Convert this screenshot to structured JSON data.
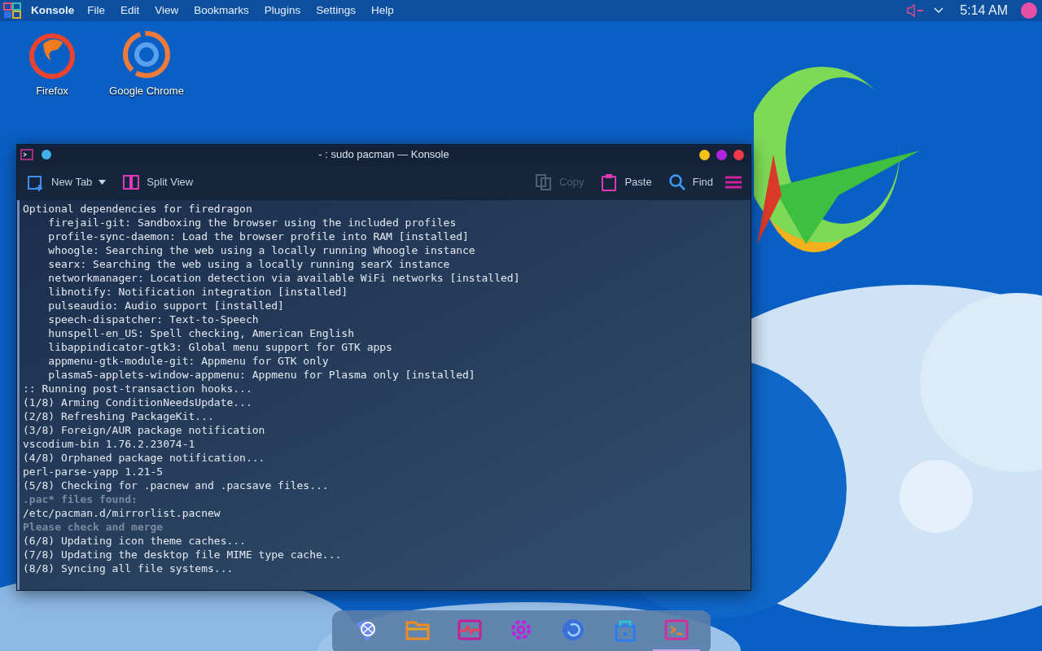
{
  "top_panel": {
    "app_name": "Konsole",
    "menu": [
      "File",
      "Edit",
      "View",
      "Bookmarks",
      "Plugins",
      "Settings",
      "Help"
    ],
    "clock": "5:14 AM",
    "volume_muted": true
  },
  "desktop_icons": [
    {
      "label": "Firefox",
      "kind": "firefox"
    },
    {
      "label": "Google Chrome",
      "kind": "chrome"
    }
  ],
  "window": {
    "title": "- : sudo pacman — Konsole",
    "toolbar": [
      {
        "label": "New Tab",
        "kind": "new-tab",
        "disabled": false
      },
      {
        "label": "Split View",
        "kind": "split",
        "disabled": false
      },
      {
        "label": "Copy",
        "kind": "copy",
        "disabled": true
      },
      {
        "label": "Paste",
        "kind": "paste",
        "disabled": false
      },
      {
        "label": "Find",
        "kind": "find",
        "disabled": false
      }
    ],
    "terminal_lines": [
      {
        "text": "Optional dependencies for firedragon",
        "kind": "normal"
      },
      {
        "text": "    firejail-git: Sandboxing the browser using the included profiles",
        "kind": "normal"
      },
      {
        "text": "    profile-sync-daemon: Load the browser profile into RAM [installed]",
        "kind": "normal"
      },
      {
        "text": "    whoogle: Searching the web using a locally running Whoogle instance",
        "kind": "normal"
      },
      {
        "text": "    searx: Searching the web using a locally running searX instance",
        "kind": "normal"
      },
      {
        "text": "    networkmanager: Location detection via available WiFi networks [installed]",
        "kind": "normal"
      },
      {
        "text": "    libnotify: Notification integration [installed]",
        "kind": "normal"
      },
      {
        "text": "    pulseaudio: Audio support [installed]",
        "kind": "normal"
      },
      {
        "text": "    speech-dispatcher: Text-to-Speech",
        "kind": "normal"
      },
      {
        "text": "    hunspell-en_US: Spell checking, American English",
        "kind": "normal"
      },
      {
        "text": "    libappindicator-gtk3: Global menu support for GTK apps",
        "kind": "normal"
      },
      {
        "text": "    appmenu-gtk-module-git: Appmenu for GTK only",
        "kind": "normal"
      },
      {
        "text": "    plasma5-applets-window-appmenu: Appmenu for Plasma only [installed]",
        "kind": "normal"
      },
      {
        "text": ":: Running post-transaction hooks...",
        "kind": "normal"
      },
      {
        "text": "(1/8) Arming ConditionNeedsUpdate...",
        "kind": "normal"
      },
      {
        "text": "(2/8) Refreshing PackageKit...",
        "kind": "normal"
      },
      {
        "text": "(3/8) Foreign/AUR package notification",
        "kind": "normal"
      },
      {
        "text": "vscodium-bin 1.76.2.23074-1",
        "kind": "normal"
      },
      {
        "text": "(4/8) Orphaned package notification...",
        "kind": "normal"
      },
      {
        "text": "perl-parse-yapp 1.21-5",
        "kind": "normal"
      },
      {
        "text": "(5/8) Checking for .pacnew and .pacsave files...",
        "kind": "normal"
      },
      {
        "text": ".pac* files found:",
        "kind": "dim"
      },
      {
        "text": "/etc/pacman.d/mirrorlist.pacnew",
        "kind": "normal"
      },
      {
        "text": "Please check and merge",
        "kind": "dim"
      },
      {
        "text": "(6/8) Updating icon theme caches...",
        "kind": "normal"
      },
      {
        "text": "(7/8) Updating the desktop file MIME type cache...",
        "kind": "normal"
      },
      {
        "text": "(8/8) Syncing all file systems...",
        "kind": "normal"
      }
    ]
  },
  "dock": [
    {
      "kind": "globe",
      "selected": false
    },
    {
      "kind": "folder",
      "selected": false
    },
    {
      "kind": "monitor",
      "selected": false
    },
    {
      "kind": "settings",
      "selected": false
    },
    {
      "kind": "update",
      "selected": false
    },
    {
      "kind": "store",
      "selected": false
    },
    {
      "kind": "terminal",
      "selected": true
    }
  ]
}
